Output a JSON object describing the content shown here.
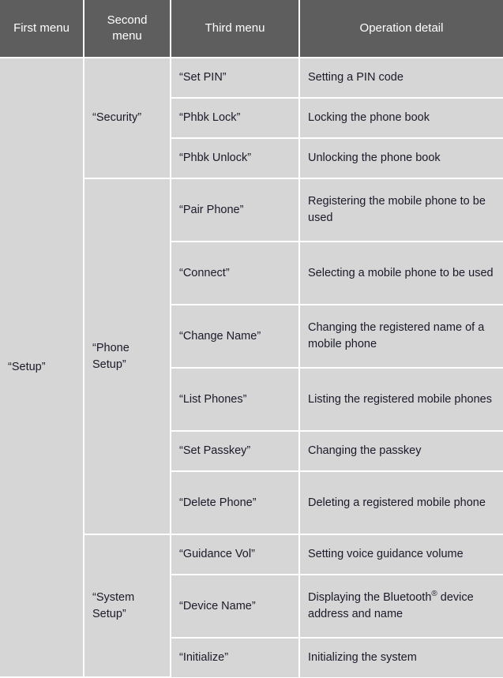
{
  "table": {
    "headers": [
      {
        "label": "First menu"
      },
      {
        "label": "Second menu"
      },
      {
        "label": "Third menu"
      },
      {
        "label": "Operation detail"
      }
    ],
    "first_menu": {
      "label": "“Setup”"
    },
    "groups": [
      {
        "second_menu": "“Security”",
        "rows": [
          {
            "third_menu": "“Set PIN”",
            "detail": "Setting a PIN code",
            "lines": 1
          },
          {
            "third_menu": "“Phbk Lock”",
            "detail": "Locking the phone book",
            "lines": 1
          },
          {
            "third_menu": "“Phbk Unlock”",
            "detail": "Unlocking the phone book",
            "lines": 1
          }
        ]
      },
      {
        "second_menu": "“Phone Setup”",
        "rows": [
          {
            "third_menu": "“Pair Phone”",
            "detail": "Registering the mobile phone to be used",
            "lines": 2
          },
          {
            "third_menu": "“Connect”",
            "detail": "Selecting a mobile phone to be used",
            "lines": 2
          },
          {
            "third_menu": "“Change Name”",
            "detail": "Changing the registered name of a mobile phone",
            "lines": 2
          },
          {
            "third_menu": "“List Phones”",
            "detail": "Listing the registered mobile phones",
            "lines": 2
          },
          {
            "third_menu": "“Set Passkey”",
            "detail": "Changing the passkey",
            "lines": 1
          },
          {
            "third_menu": "“Delete Phone”",
            "detail": "Deleting a registered mobile phone",
            "lines": 2
          }
        ]
      },
      {
        "second_menu": "“System Setup”",
        "rows": [
          {
            "third_menu": "“Guidance Vol”",
            "detail": "Setting voice guidance volume",
            "lines": 1
          },
          {
            "third_menu": "“Device Name”",
            "detail_pre": "Displaying the Bluetooth",
            "detail_sup": "®",
            "detail_post": " device address and name",
            "lines": 2
          },
          {
            "third_menu": "“Initialize”",
            "detail": "Initializing the system",
            "lines": 1
          }
        ]
      }
    ]
  },
  "colors": {
    "header_bg": "#5e5e5e",
    "header_text": "#ffffff",
    "cell_bg": "#d6d6d6",
    "cell_text": "#1a1a2a",
    "grid_line": "#ffffff"
  }
}
